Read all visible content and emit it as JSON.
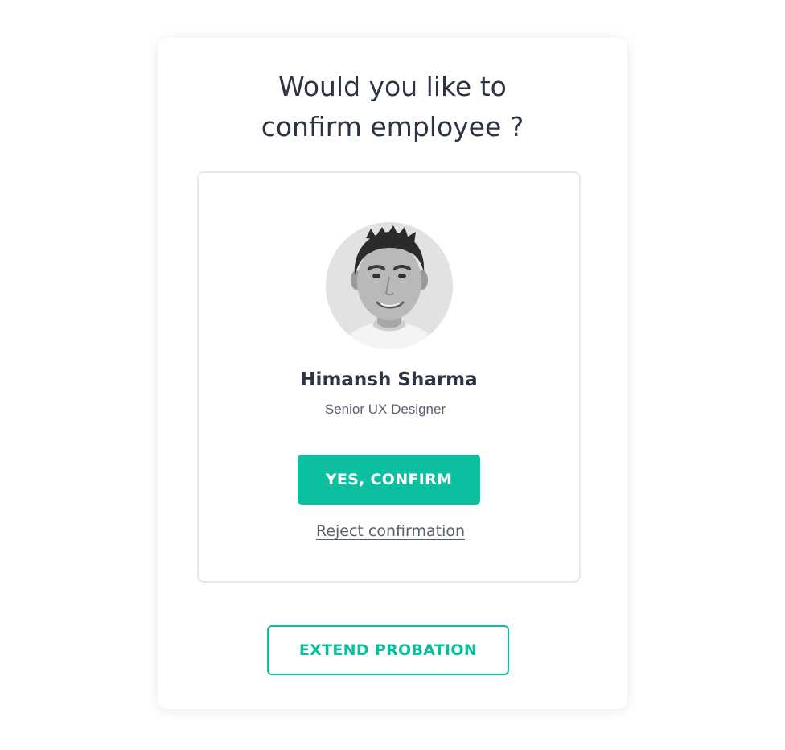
{
  "dialog": {
    "title_line1": "Would you like to",
    "title_line2": "confirm employee ?"
  },
  "employee": {
    "name": "Himansh Sharma",
    "role": "Senior UX Designer",
    "avatar_icon": "employee-photo"
  },
  "actions": {
    "confirm_label": "YES, CONFIRM",
    "reject_label": "Reject confirmation",
    "extend_label": "EXTEND PROBATION"
  },
  "colors": {
    "accent": "#0cbf9f",
    "heading": "#2c3345",
    "muted": "#5a6070",
    "border": "#e7e8eb"
  }
}
